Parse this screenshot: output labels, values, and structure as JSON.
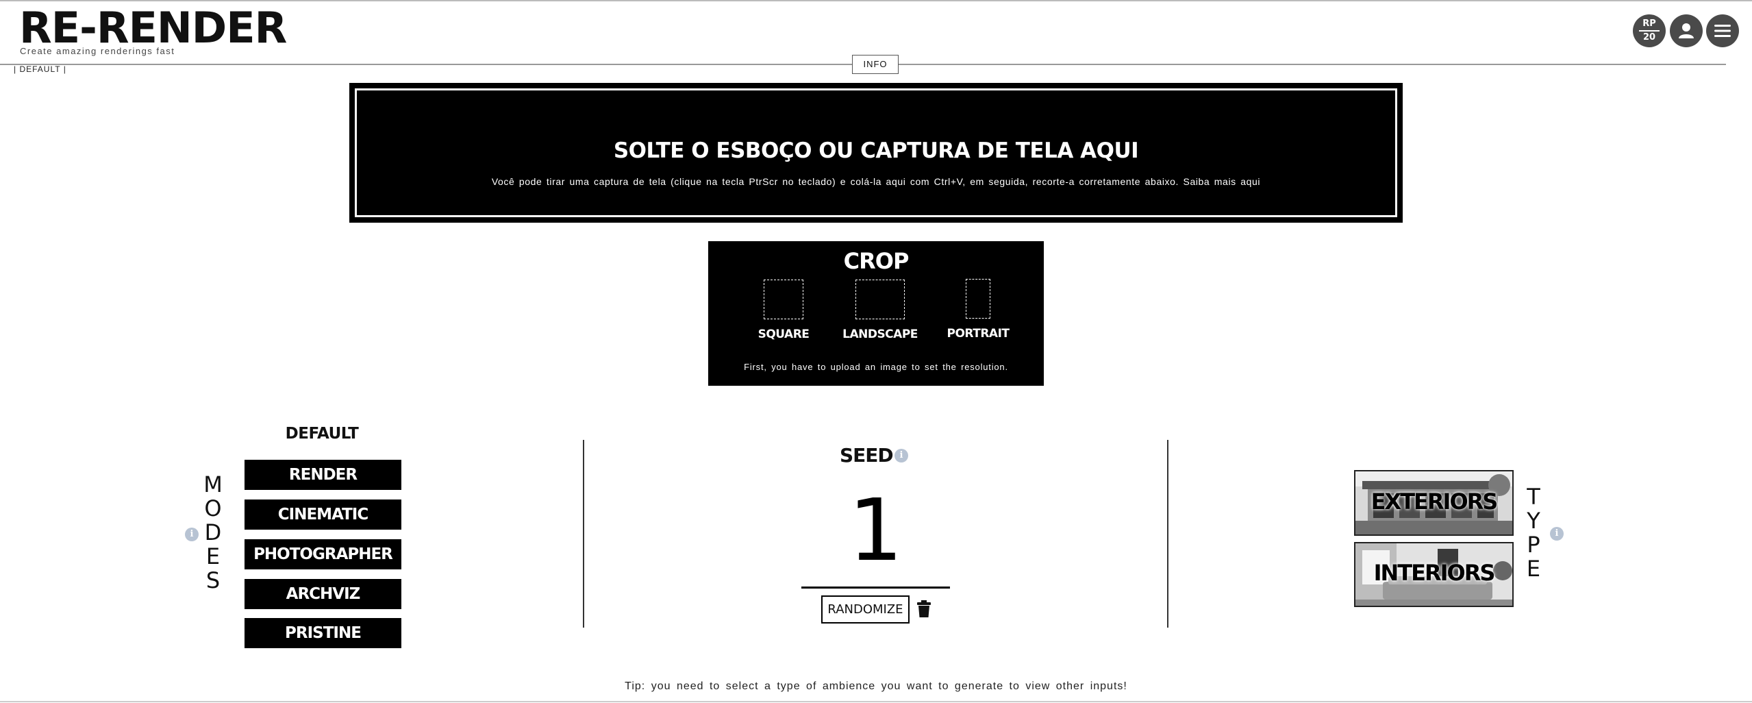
{
  "header": {
    "logo": "RE-RENDER",
    "tagline": "Create amazing renderings fast",
    "info_label": "INFO",
    "mode_tag": "| DEFAULT |",
    "credits_top": "RP",
    "credits_bottom": "20"
  },
  "dropzone": {
    "title": "SOLTE O ESBOÇO OU CAPTURA DE TELA AQUI",
    "subtitle": "Você pode tirar uma captura de tela (clique na tecla PtrScr no teclado) e colá-la aqui com Ctrl+V, em seguida, recorte-a corretamente abaixo. Saiba mais aqui"
  },
  "crop": {
    "title": "CROP",
    "options": [
      {
        "label": "SQUARE"
      },
      {
        "label": "LANDSCAPE"
      },
      {
        "label": "PORTRAIT"
      }
    ],
    "note": "First, you have to upload an image to set the resolution."
  },
  "modes": {
    "vertical_label": "MODES",
    "default_label": "DEFAULT",
    "items": [
      "RENDER",
      "CINEMATIC",
      "PHOTOGRAPHER",
      "ARCHVIZ",
      "PRISTINE"
    ]
  },
  "seed": {
    "title": "SEED",
    "value": "1",
    "randomize_label": "RANDOMIZE"
  },
  "types": {
    "vertical_label": "TYPE",
    "items": [
      "EXTERIORS",
      "INTERIORS"
    ]
  },
  "footer": {
    "tip": "Tip: you need to select a type of ambience you want to generate to view other inputs!"
  },
  "icons": {
    "info": "info-icon",
    "user": "user-icon",
    "menu": "hamburger-menu-icon",
    "trash": "trash-icon"
  },
  "colors": {
    "primary": "#000000",
    "background": "#ffffff",
    "header_buttons": "#4a4a4a",
    "info_dot": "#b7c3d3"
  }
}
